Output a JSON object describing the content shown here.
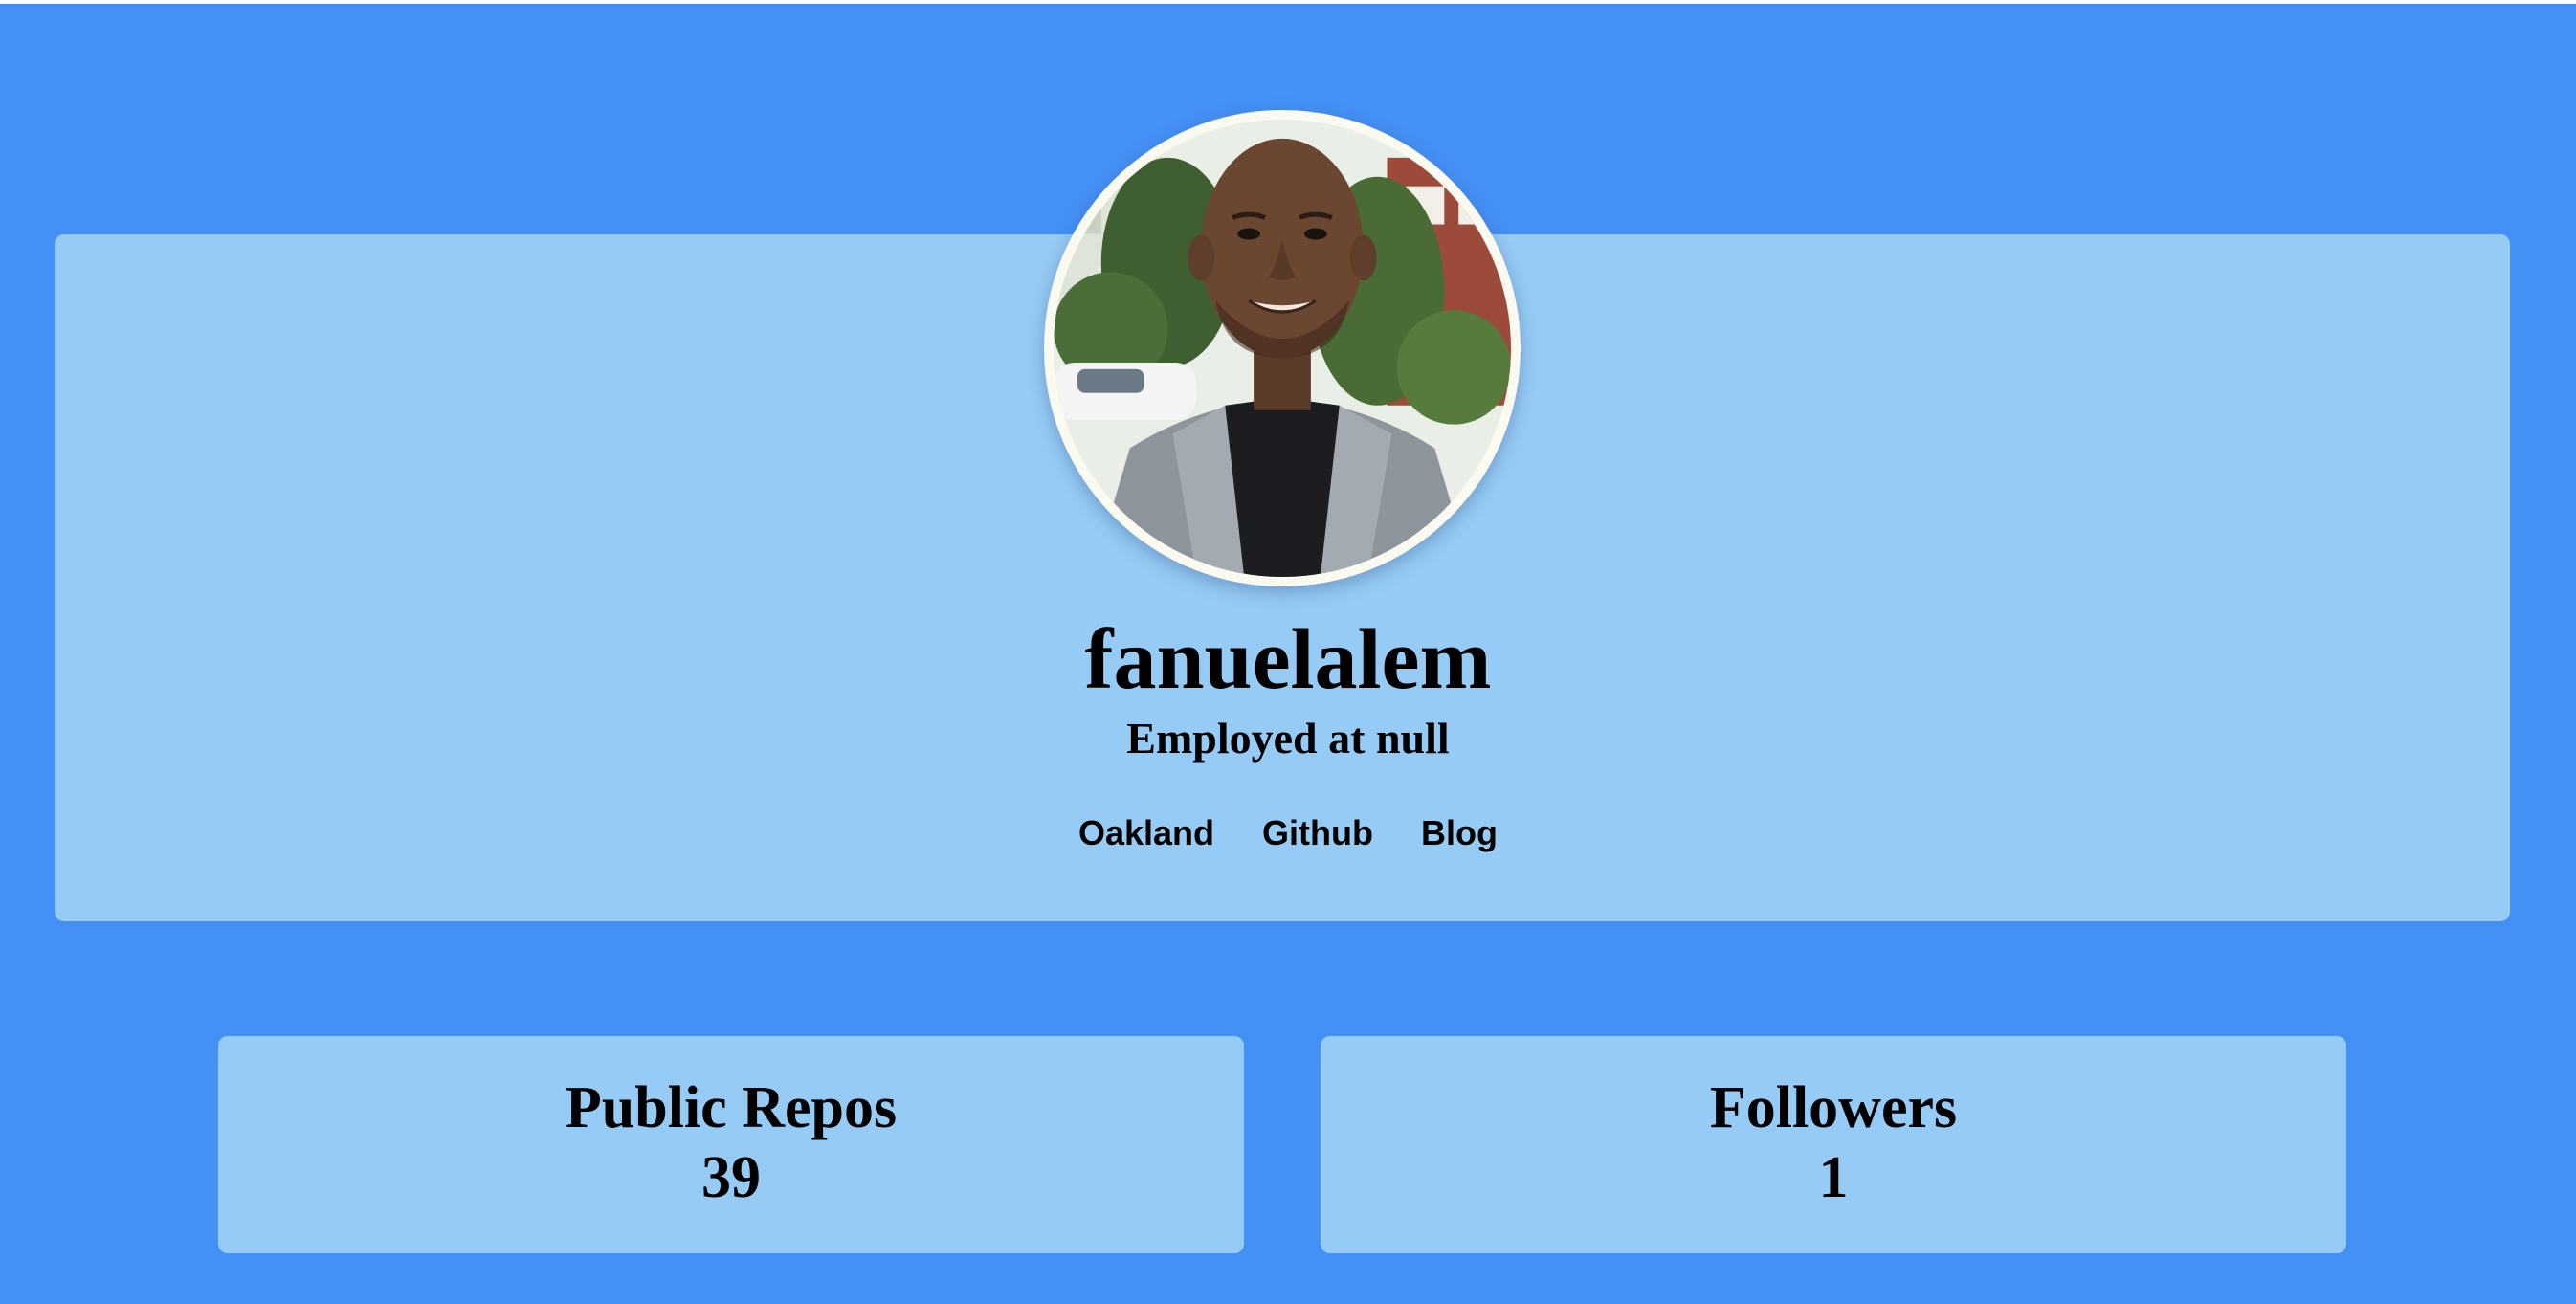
{
  "colors": {
    "page_background": "#4590f5",
    "card_background": "#96cbf5",
    "avatar_border": "#fbfaf0",
    "text": "#000000"
  },
  "profile": {
    "avatar_icon": "profile-photo",
    "username": "fanuelalem",
    "employment": "Employed at null",
    "links": [
      {
        "label": "Oakland"
      },
      {
        "label": "Github"
      },
      {
        "label": "Blog"
      }
    ]
  },
  "stats": {
    "public_repos": {
      "label": "Public Repos",
      "value": "39"
    },
    "followers": {
      "label": "Followers",
      "value": "1"
    }
  }
}
